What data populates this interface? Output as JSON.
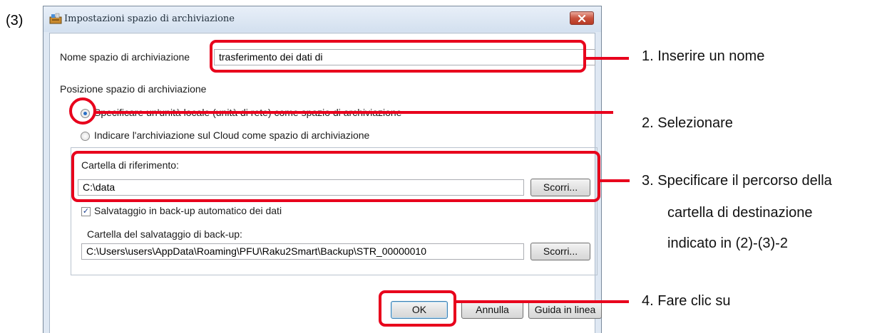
{
  "step_label": "(3)",
  "window": {
    "title": "Impostazioni spazio di archiviazione"
  },
  "name_section": {
    "label": "Nome spazio di archiviazione",
    "value": "trasferimento dei dati di"
  },
  "position_section": {
    "heading": "Posizione spazio di archiviazione",
    "radio_local": "Specificare un'unità locale (unità di rete) come spazio di archiviazione",
    "radio_cloud": "Indicare l'archiviazione sul Cloud come spazio di archiviazione"
  },
  "reference_folder": {
    "label": "Cartella di riferimento:",
    "value": "C:\\data",
    "browse": "Scorri..."
  },
  "backup": {
    "checkbox_label": "Salvataggio in back-up automatico dei dati",
    "folder_label": "Cartella del salvataggio di back-up:",
    "folder_value": "C:\\Users\\users\\AppData\\Roaming\\PFU\\Raku2Smart\\Backup\\STR_00000010",
    "browse": "Scorri..."
  },
  "buttons": {
    "ok": "OK",
    "cancel": "Annulla",
    "help": "Guida in linea"
  },
  "annotations": {
    "a1": "1. Inserire un nome",
    "a2": "2. Selezionare",
    "a3_line1": "3. Specificare il percorso della",
    "a3_line2": "cartella di destinazione",
    "a3_line3": "indicato in (2)-(3)-2",
    "a4": "4. Fare clic su"
  },
  "colors": {
    "highlight": "#e8001c",
    "title_bar": "#dfe8f3",
    "close_button": "#c9523d"
  }
}
